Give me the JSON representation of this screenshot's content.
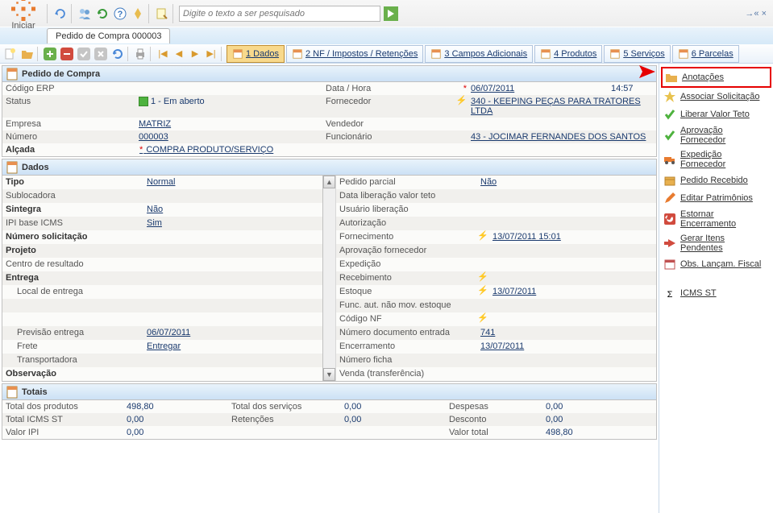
{
  "top": {
    "iniciar": "Iniciar",
    "search_placeholder": "Digite o texto a ser pesquisado",
    "tab_title": "Pedido de Compra 000003"
  },
  "maintabs": [
    {
      "label": "1 Dados",
      "sel": true
    },
    {
      "label": "2 NF / Impostos / Retenções"
    },
    {
      "label": "3 Campos Adicionais"
    },
    {
      "label": "4 Produtos"
    },
    {
      "label": "5 Serviços"
    },
    {
      "label": "6 Parcelas"
    }
  ],
  "header": {
    "title": "Pedido de Compra",
    "fields": {
      "codigo_erp": {
        "label": "Código ERP",
        "value": ""
      },
      "data_hora": {
        "label": "Data / Hora",
        "value": "06/07/2011",
        "time": "14:57",
        "req": true
      },
      "status": {
        "label": "Status",
        "value": "1 - Em aberto"
      },
      "fornecedor": {
        "label": "Fornecedor",
        "value": "340 - KEEPING PEÇAS PARA TRATORES LTDA",
        "bolt": true
      },
      "empresa": {
        "label": "Empresa",
        "value": "MATRIZ"
      },
      "vendedor": {
        "label": "Vendedor",
        "value": ""
      },
      "numero": {
        "label": "Número",
        "value": "000003"
      },
      "funcionario": {
        "label": "Funcionário",
        "value": "43 - JOCIMAR FERNANDES DOS SANTOS"
      },
      "alcada": {
        "label": "Alçada",
        "value": "COMPRA PRODUTO/SERVIÇO",
        "req": true
      }
    }
  },
  "dados": {
    "title": "Dados",
    "left": [
      {
        "label": "Tipo",
        "value": "Normal",
        "bold": true
      },
      {
        "label": "Sublocadora"
      },
      {
        "label": "Sintegra",
        "value": "Não",
        "bold": true
      },
      {
        "label": "IPI base ICMS",
        "value": "Sim"
      },
      {
        "label": "Número solicitação",
        "bold": true
      },
      {
        "label": "Projeto",
        "bold": true
      },
      {
        "label": "Centro de resultado"
      },
      {
        "label": "Entrega",
        "bold": true
      },
      {
        "label": "Local de entrega",
        "indent": true
      },
      {
        "label": ""
      },
      {
        "label": ""
      },
      {
        "label": "Previsão entrega",
        "value": "06/07/2011",
        "indent": true
      },
      {
        "label": "Frete",
        "value": "Entregar",
        "indent": true
      },
      {
        "label": "Transportadora",
        "indent": true
      },
      {
        "label": "Observação",
        "bold": true
      }
    ],
    "right": [
      {
        "label": "Pedido parcial",
        "value": "Não"
      },
      {
        "label": "Data liberação valor teto"
      },
      {
        "label": "Usuário liberação"
      },
      {
        "label": "Autorização"
      },
      {
        "label": "Fornecimento",
        "value": "13/07/2011 15:01",
        "bolt": true
      },
      {
        "label": "Aprovação fornecedor"
      },
      {
        "label": "Expedição"
      },
      {
        "label": "Recebimento",
        "bolt": true
      },
      {
        "label": "Estoque",
        "value": "13/07/2011",
        "bolt": true
      },
      {
        "label": "Func. aut. não mov. estoque"
      },
      {
        "label": "Código NF",
        "bolt": true
      },
      {
        "label": "Número documento entrada",
        "value": "741"
      },
      {
        "label": "Encerramento",
        "value": "13/07/2011"
      },
      {
        "label": "Número ficha"
      },
      {
        "label": "Venda (transferência)"
      }
    ]
  },
  "totais": {
    "title": "Totais",
    "rows": [
      [
        "Total dos produtos",
        "498,80",
        "Total dos serviços",
        "0,00",
        "Despesas",
        "0,00"
      ],
      [
        "Total ICMS ST",
        "0,00",
        "Retenções",
        "0,00",
        "Desconto",
        "0,00"
      ],
      [
        "Valor IPI",
        "0,00",
        "",
        "",
        "Valor total",
        "498,80"
      ]
    ]
  },
  "side": [
    {
      "key": "anotacoes",
      "label": "Anotações",
      "hot": true,
      "icon": "folder"
    },
    {
      "key": "associar",
      "label": "Associar Solicitação",
      "icon": "star"
    },
    {
      "key": "liberar",
      "label": "Liberar Valor Teto",
      "icon": "check"
    },
    {
      "key": "aprov-fornec",
      "label": "Aprovação Fornecedor",
      "icon": "check"
    },
    {
      "key": "exped-fornec",
      "label": "Expedição Fornecedor",
      "icon": "truck"
    },
    {
      "key": "pedido-receb",
      "label": "Pedido Recebido",
      "icon": "box"
    },
    {
      "key": "editar-patr",
      "label": "Editar Patrimônios",
      "icon": "pencil"
    },
    {
      "key": "estornar",
      "label": "Estornar Encerramento",
      "icon": "undo"
    },
    {
      "key": "gerar-pend",
      "label": "Gerar Itens Pendentes",
      "icon": "arrow"
    },
    {
      "key": "obs-fiscal",
      "label": "Obs. Lançam. Fiscal",
      "icon": "cal"
    },
    {
      "key": "icms-st",
      "label": "ICMS ST",
      "icon": "sigma"
    }
  ]
}
